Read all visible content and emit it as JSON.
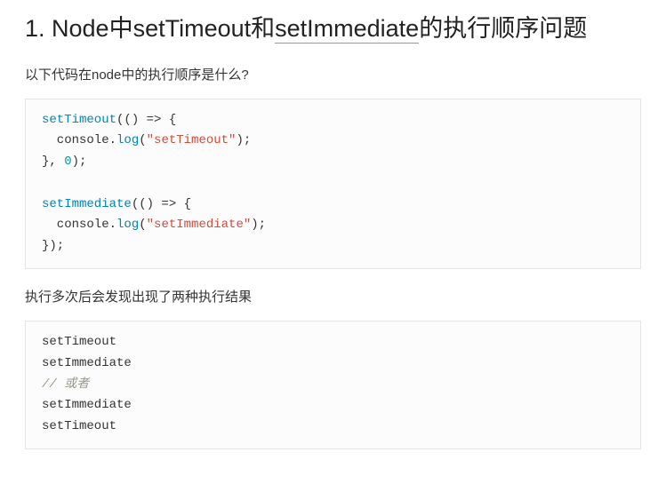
{
  "heading": {
    "prefix": "1. Node中setTimeout和",
    "underlined": "setImmediate",
    "suffix": "的执行顺序问题"
  },
  "para1": "以下代码在node中的执行顺序是什么?",
  "code1": {
    "l1a": "setTimeout",
    "l1b": "(() => {",
    "l2a": "  console.",
    "l2b": "log",
    "l2c": "(",
    "l2d": "\"setTimeout\"",
    "l2e": ");",
    "l3a": "}, ",
    "l3b": "0",
    "l3c": ");",
    "l5a": "setImmediate",
    "l5b": "(() => {",
    "l6a": "  console.",
    "l6b": "log",
    "l6c": "(",
    "l6d": "\"setImmediate\"",
    "l6e": ");",
    "l7a": "});"
  },
  "para2": "执行多次后会发现出现了两种执行结果",
  "code2": {
    "l1": "setTimeout",
    "l2": "setImmediate",
    "l3": "// 或者",
    "l4": "setImmediate",
    "l5": "setTimeout"
  }
}
